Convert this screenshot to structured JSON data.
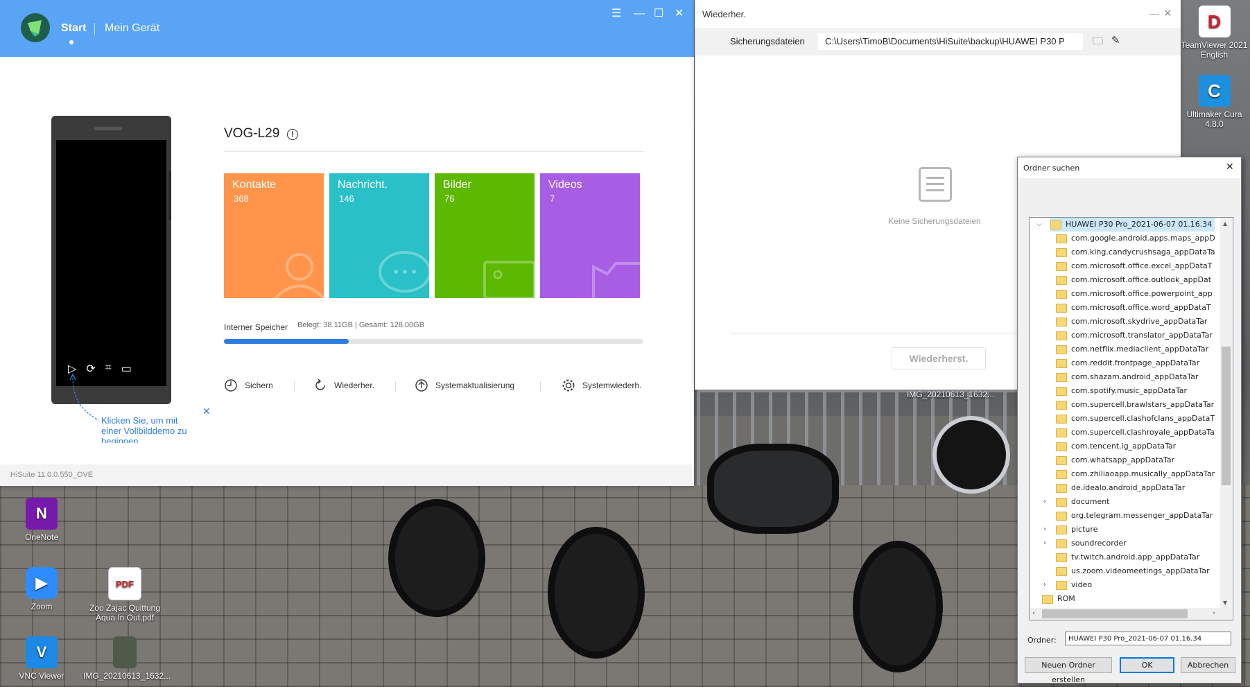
{
  "hisuite": {
    "tabs": [
      "Start",
      "Mein Gerät"
    ],
    "device_name": "VOG-L29",
    "tiles": [
      {
        "label": "Kontakte",
        "count": "368",
        "color": "#ff944a"
      },
      {
        "label": "Nachricht.",
        "count": "146",
        "color": "#29c0c7"
      },
      {
        "label": "Bilder",
        "count": "76",
        "color": "#5cb800"
      },
      {
        "label": "Videos",
        "count": "7",
        "color": "#a85ee4"
      }
    ],
    "storage": {
      "label": "Interner Speicher",
      "detail": "Belegt: 38.11GB | Gesamt: 128.00GB",
      "used_fraction": 0.298
    },
    "actions": [
      "Sichern",
      "Wiederher.",
      "Systemaktualisierung",
      "Systemwiederh."
    ],
    "demo_hint": "Klicken Sie, um mit einer Vollbilddemo zu beginnen",
    "version": "HiSuite 11.0.0.550_OVE"
  },
  "restore": {
    "title": "Wiederher.",
    "backup_label": "Sicherungsdateien",
    "backup_path": "C:\\Users\\TimoB\\Documents\\HiSuite\\backup\\HUAWEI P30 P",
    "empty_text": "Keine Sicherungsdateien",
    "restore_button": "Wiederherst."
  },
  "dialog": {
    "title": "Ordner suchen",
    "root": "HUAWEI P30 Pro_2021-06-07 01.16.34",
    "items": [
      {
        "label": "com.google.android.apps.maps_appD",
        "expandable": false
      },
      {
        "label": "com.king.candycrushsaga_appDataTa",
        "expandable": false
      },
      {
        "label": "com.microsoft.office.excel_appDataT",
        "expandable": false
      },
      {
        "label": "com.microsoft.office.outlook_appDat",
        "expandable": false
      },
      {
        "label": "com.microsoft.office.powerpoint_app",
        "expandable": false
      },
      {
        "label": "com.microsoft.office.word_appDataT",
        "expandable": false
      },
      {
        "label": "com.microsoft.skydrive_appDataTar",
        "expandable": false
      },
      {
        "label": "com.microsoft.translator_appDataTar",
        "expandable": false
      },
      {
        "label": "com.netflix.mediaclient_appDataTar",
        "expandable": false
      },
      {
        "label": "com.reddit.frontpage_appDataTar",
        "expandable": false
      },
      {
        "label": "com.shazam.android_appDataTar",
        "expandable": false
      },
      {
        "label": "com.spotify.music_appDataTar",
        "expandable": false
      },
      {
        "label": "com.supercell.brawlstars_appDataTar",
        "expandable": false
      },
      {
        "label": "com.supercell.clashofclans_appDataT",
        "expandable": false
      },
      {
        "label": "com.supercell.clashroyale_appDataTa",
        "expandable": false
      },
      {
        "label": "com.tencent.ig_appDataTar",
        "expandable": false
      },
      {
        "label": "com.whatsapp_appDataTar",
        "expandable": false
      },
      {
        "label": "com.zhiliaoapp.musically_appDataTar",
        "expandable": false
      },
      {
        "label": "de.idealo.android_appDataTar",
        "expandable": false
      },
      {
        "label": "document",
        "expandable": true
      },
      {
        "label": "org.telegram.messenger_appDataTar",
        "expandable": false
      },
      {
        "label": "picture",
        "expandable": true
      },
      {
        "label": "soundrecorder",
        "expandable": true
      },
      {
        "label": "tv.twitch.android.app_appDataTar",
        "expandable": false
      },
      {
        "label": "us.zoom.videomeetings_appDataTar",
        "expandable": false
      },
      {
        "label": "video",
        "expandable": true
      }
    ],
    "sibling": "ROM",
    "folder_label": "Ordner:",
    "folder_value": "HUAWEI P30 Pro_2021-06-07 01.16.34",
    "new_folder": "Neuen Ordner erstellen",
    "ok": "OK",
    "cancel": "Abbrechen"
  },
  "desktop": {
    "icons": [
      "OneNote",
      "Zoom",
      "Zoo Zajac Quittung Aqua In Out.pdf",
      "VNC Viewer",
      "IMG_20210613_1632...",
      "TeamViewer 2021 English",
      "Ultimaker Cura 4.8.0"
    ],
    "photo_label": "IMG_20210613_1632..."
  }
}
